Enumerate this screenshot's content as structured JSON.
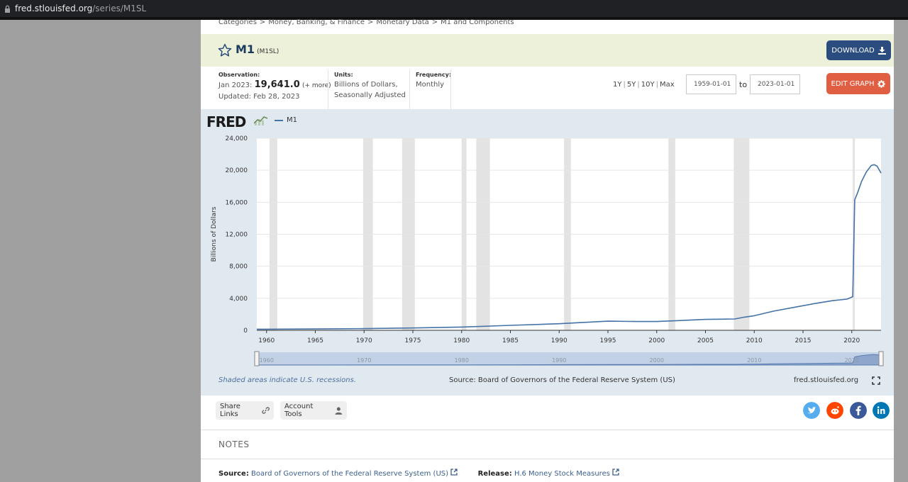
{
  "browser": {
    "url_host": "fred.stlouisfed.org",
    "url_path": "/series/M1SL"
  },
  "breadcrumb": [
    "Categories",
    "Money, Banking, & Finance",
    "Monetary Data",
    "M1 and Components"
  ],
  "breadcrumb_sep": ">",
  "series": {
    "title": "M1",
    "id": "(M1SL)"
  },
  "download_label": "DOWNLOAD",
  "observation": {
    "label": "Observation:",
    "date": "Jan 2023:",
    "value": "19,641.0",
    "more": "(+ more)",
    "updated": "Updated: Feb 28, 2023"
  },
  "units": {
    "label": "Units:",
    "line1": "Billions of Dollars,",
    "line2": "Seasonally Adjusted"
  },
  "frequency": {
    "label": "Frequency:",
    "value": "Monthly"
  },
  "ranges": [
    "1Y",
    "5Y",
    "10Y",
    "Max"
  ],
  "date_from": "1959-01-01",
  "date_to": "2023-01-01",
  "to_label": "to",
  "edit_graph_label": "EDIT GRAPH",
  "graph": {
    "logo": "FRED",
    "recession_note": "Shaded areas indicate U.S. recessions.",
    "source_note": "Source: Board of Governors of the Federal Reserve System (US)",
    "site": "fred.stlouisfed.org"
  },
  "share_label": "Share Links",
  "account_label": "Account Tools",
  "social": [
    {
      "name": "twitter",
      "color": "#55acee"
    },
    {
      "name": "reddit",
      "color": "#ff4500"
    },
    {
      "name": "facebook",
      "color": "#3b5998"
    },
    {
      "name": "linkedin",
      "color": "#0077b5"
    }
  ],
  "notes_title": "NOTES",
  "source": {
    "label": "Source:",
    "text": "Board of Governors of the Federal Reserve System (US)"
  },
  "release": {
    "label": "Release:",
    "text": "H.6 Money Stock Measures"
  },
  "chart_data": {
    "type": "line",
    "series": [
      {
        "name": "M1",
        "color": "#4572a7",
        "x": [
          1959,
          1960,
          1965,
          1970,
          1975,
          1980,
          1985,
          1990,
          1995,
          1998,
          2000,
          2002,
          2005,
          2008,
          2009,
          2010,
          2012,
          2014,
          2016,
          2018,
          2019.5,
          2020.1,
          2020.3,
          2020.6,
          2021.0,
          2021.5,
          2022.0,
          2022.3,
          2022.6,
          2023.0
        ],
        "y": [
          139,
          141,
          168,
          215,
          288,
          408,
          620,
          820,
          1140,
          1100,
          1100,
          1200,
          1360,
          1420,
          1650,
          1820,
          2400,
          2850,
          3300,
          3700,
          3900,
          4200,
          16300,
          17200,
          18600,
          19800,
          20600,
          20700,
          20500,
          19641
        ]
      }
    ],
    "recessions": [
      [
        1960.3,
        1961.1
      ],
      [
        1969.9,
        1970.9
      ],
      [
        1973.9,
        1975.2
      ],
      [
        1980.0,
        1980.5
      ],
      [
        1981.5,
        1982.9
      ],
      [
        1990.5,
        1991.2
      ],
      [
        2001.2,
        2001.9
      ],
      [
        2007.9,
        2009.5
      ],
      [
        2020.1,
        2020.3
      ]
    ],
    "xlim": [
      1959,
      2023
    ],
    "ylim": [
      0,
      24000
    ],
    "ylabel": "Billions of Dollars",
    "xticks": [
      1960,
      1965,
      1970,
      1975,
      1980,
      1985,
      1990,
      1995,
      2000,
      2005,
      2010,
      2015,
      2020
    ],
    "yticks": [
      0,
      4000,
      8000,
      12000,
      16000,
      20000,
      24000
    ],
    "ytick_labels": [
      "0",
      "4,000",
      "8,000",
      "12,000",
      "16,000",
      "20,000",
      "24,000"
    ],
    "navigator_ticks": [
      1960,
      1970,
      1980,
      1990,
      2000,
      2010,
      2020
    ],
    "grid": true
  }
}
